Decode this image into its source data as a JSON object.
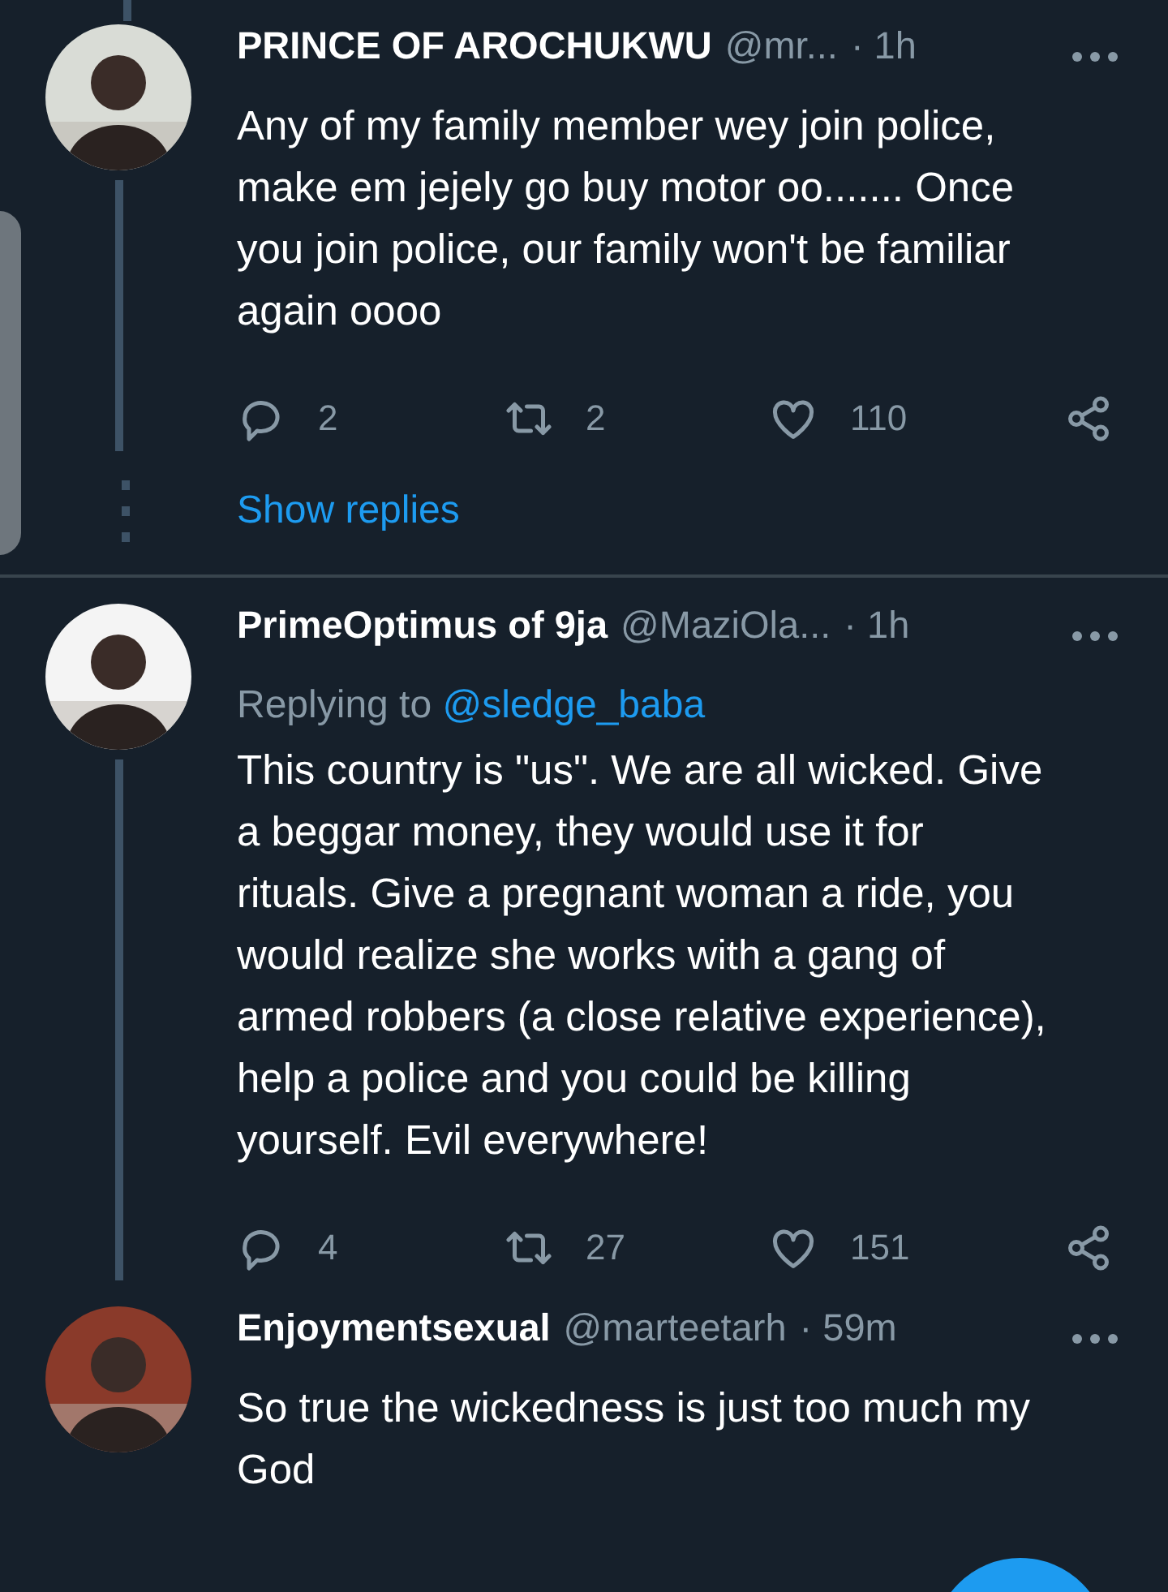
{
  "tweets": [
    {
      "name": "PRINCE OF AROCHUKWU",
      "handle": "@mr...",
      "time": "· 1h",
      "connected_above": true,
      "connected_below": true,
      "body": "Any of my family member wey join police, make em jejely go buy motor oo....... Once you join police, our family won't be familiar again oooo",
      "replies": "2",
      "retweets": "2",
      "likes": "110",
      "show_replies": "Show replies"
    },
    {
      "name": "PrimeOptimus of 9ja",
      "handle": "@MaziOla...",
      "time": "· 1h",
      "connected_above": false,
      "connected_below": true,
      "replying_label": "Replying to",
      "replying_to": "@sledge_baba",
      "body": "This country is \"us\". We are all wicked. Give a beggar money, they would use it for rituals. Give a pregnant woman a ride, you would realize she works with a gang of armed robbers (a close relative experience), help a police and you could be killing yourself. Evil everywhere!",
      "replies": "4",
      "retweets": "27",
      "likes": "151"
    },
    {
      "name": "Enjoymentsexual",
      "handle": "@marteetarh",
      "time": "· 59m",
      "connected_above": false,
      "connected_below": false,
      "body": "So true the wickedness is just too much my God"
    }
  ]
}
